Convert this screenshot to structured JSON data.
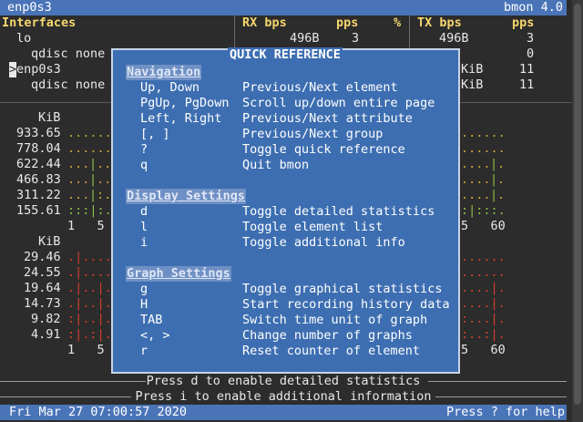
{
  "topbar": {
    "interface": "enp0s3",
    "version": "bmon 4.0"
  },
  "table": {
    "header": {
      "interfaces": "Interfaces",
      "rx_bps": "RX bps",
      "pps": "pps",
      "pct": "%",
      "tx_bps": "TX bps",
      "tx_pps": "pps"
    },
    "rows": [
      {
        "name": "lo",
        "rx": "496B",
        "rx_pps": "3",
        "tx": "496B",
        "tx_pps": "3"
      },
      {
        "name": "qdisc none",
        "tx_pps": "0"
      },
      {
        "cursor": ">",
        "name": "enp0s3",
        "tx": "KiB",
        "tx_pps": "11"
      },
      {
        "name": "qdisc none",
        "tx": "KiB",
        "tx_pps": "11"
      }
    ]
  },
  "graph_rx": {
    "unit": "KiB",
    "y_labels": [
      "933.65",
      "778.04",
      "622.44",
      "466.83",
      "311.22",
      "155.61"
    ],
    "x_ticks_left": "1   5",
    "x_ticks_right": "5   60"
  },
  "graph_tx": {
    "unit": "KiB",
    "y_labels": [
      "29.46",
      "24.55",
      "19.64",
      "14.73",
      "9.82",
      "4.91"
    ],
    "x_ticks_left": "1   5",
    "x_ticks_right": "5   60"
  },
  "popup": {
    "title": "QUICK REFERENCE",
    "sections": [
      {
        "title": "Navigation",
        "items": [
          {
            "key": "Up, Down",
            "desc": "Previous/Next element"
          },
          {
            "key": "PgUp, PgDown",
            "desc": "Scroll up/down entire page"
          },
          {
            "key": "Left, Right",
            "desc": "Previous/Next attribute"
          },
          {
            "key": "[, ]",
            "desc": "Previous/Next group"
          },
          {
            "key": "?",
            "desc": "Toggle quick reference"
          },
          {
            "key": "q",
            "desc": "Quit bmon"
          }
        ]
      },
      {
        "title": "Display Settings",
        "items": [
          {
            "key": "d",
            "desc": "Toggle detailed statistics"
          },
          {
            "key": "l",
            "desc": "Toggle element list"
          },
          {
            "key": "i",
            "desc": "Toggle additional info"
          }
        ]
      },
      {
        "title": "Graph Settings",
        "items": [
          {
            "key": "g",
            "desc": "Toggle graphical statistics"
          },
          {
            "key": "H",
            "desc": "Start recording history data"
          },
          {
            "key": "TAB",
            "desc": "Switch time unit of graph"
          },
          {
            "key": "<, >",
            "desc": "Change number of graphs"
          },
          {
            "key": "r",
            "desc": "Reset counter of element"
          }
        ]
      }
    ]
  },
  "footer": {
    "detailed": "Press d to enable detailed statistics",
    "additional": "Press i to enable additional information"
  },
  "statusbar": {
    "datetime": "Fri Mar 27 07:00:57 2020",
    "help": "Press ? for help"
  },
  "colors": {
    "bar": "#4a74b8",
    "popup": "#3d6eb1",
    "header": "#f5d76e",
    "graph_rx": "#8ac04a",
    "graph_tx": "#d2402c"
  }
}
